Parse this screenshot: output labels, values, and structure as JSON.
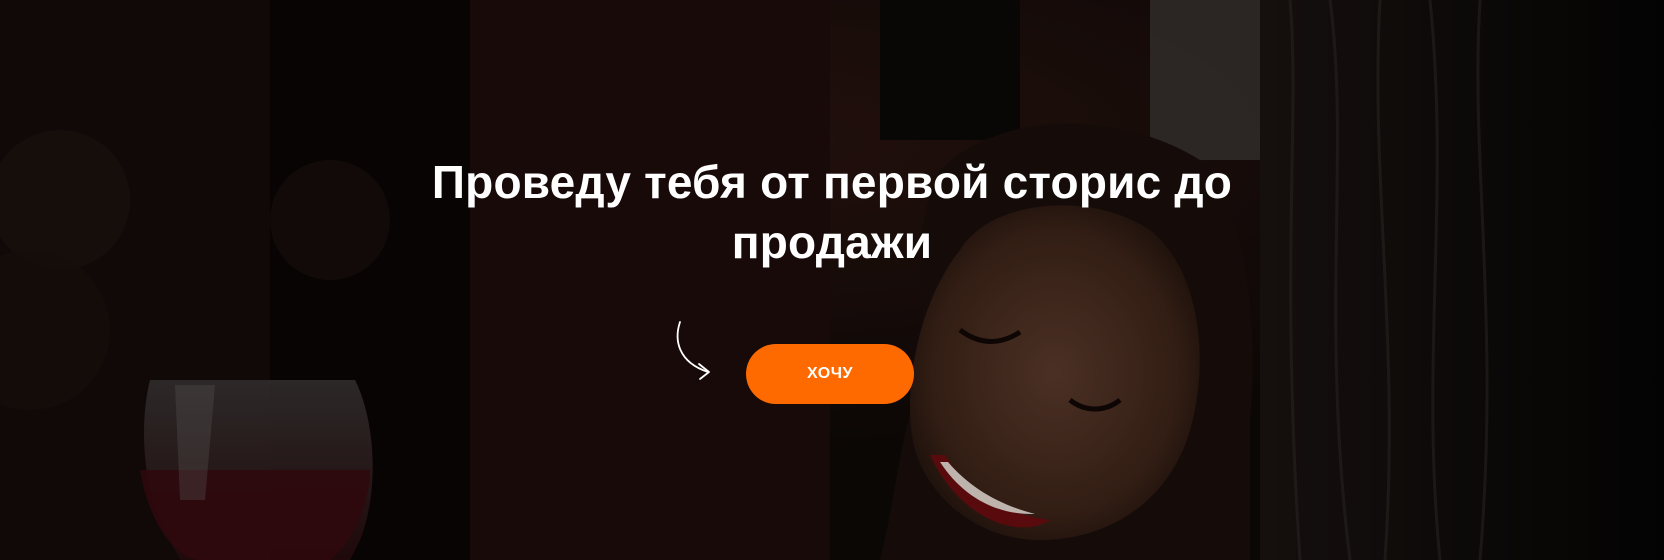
{
  "hero": {
    "headline_line1": "Проведу тебя от первой сторис до",
    "headline_line2": "продажи",
    "cta_label": "ХОЧУ",
    "accent_color": "#ff6a00",
    "background_description_icons": [
      "arrow-curved-icon"
    ]
  }
}
